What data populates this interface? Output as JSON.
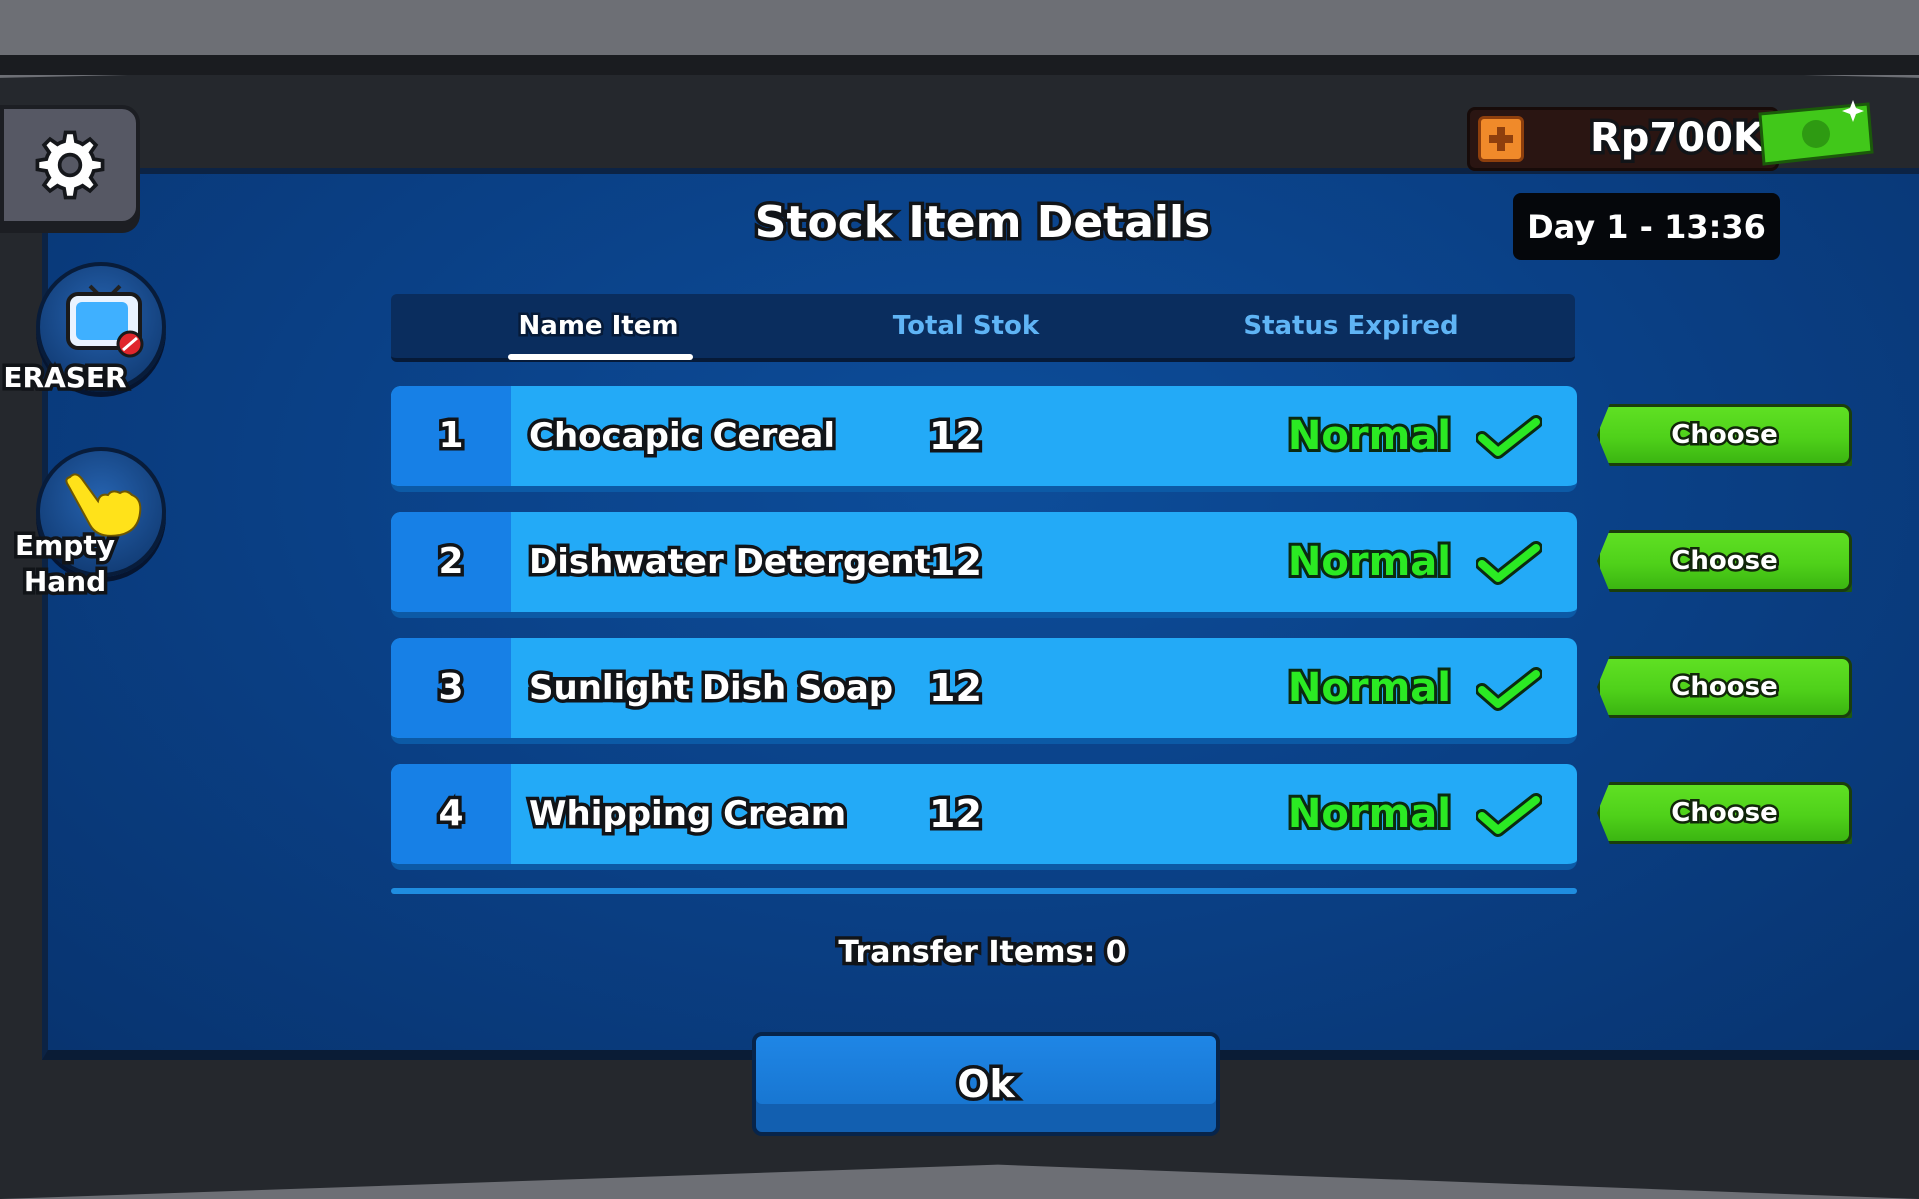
{
  "title": "Stock Item Details",
  "money": {
    "value": "Rp700K",
    "plus_icon": "plus-icon",
    "ticket_icon": "ticket-icon"
  },
  "day": "Day 1 - 13:36",
  "sidebar": {
    "settings_icon": "gear-icon",
    "tools": [
      {
        "label": "ERASER",
        "icon": "tv-eraser-icon"
      },
      {
        "label": "Empty Hand",
        "icon": "hand-pointer-icon"
      }
    ]
  },
  "tabs": [
    {
      "label": "Name Item",
      "active": true
    },
    {
      "label": "Total Stok",
      "active": false
    },
    {
      "label": "Status Expired",
      "active": false
    }
  ],
  "items": [
    {
      "num": "1",
      "name": "Chocapic Cereal",
      "qty": "12",
      "status": "Normal",
      "action": "Choose"
    },
    {
      "num": "2",
      "name": "Dishwater Detergent",
      "qty": "12",
      "status": "Normal",
      "action": "Choose"
    },
    {
      "num": "3",
      "name": "Sunlight Dish Soap",
      "qty": "12",
      "status": "Normal",
      "action": "Choose"
    },
    {
      "num": "4",
      "name": "Whipping Cream",
      "qty": "12",
      "status": "Normal",
      "action": "Choose"
    }
  ],
  "transfer_label": "Transfer Items: 0",
  "ok_label": "Ok",
  "colors": {
    "panel": "#0a3f84",
    "row": "#23aaf7",
    "status_green": "#2bea23",
    "button_green": "#4fd11a"
  }
}
